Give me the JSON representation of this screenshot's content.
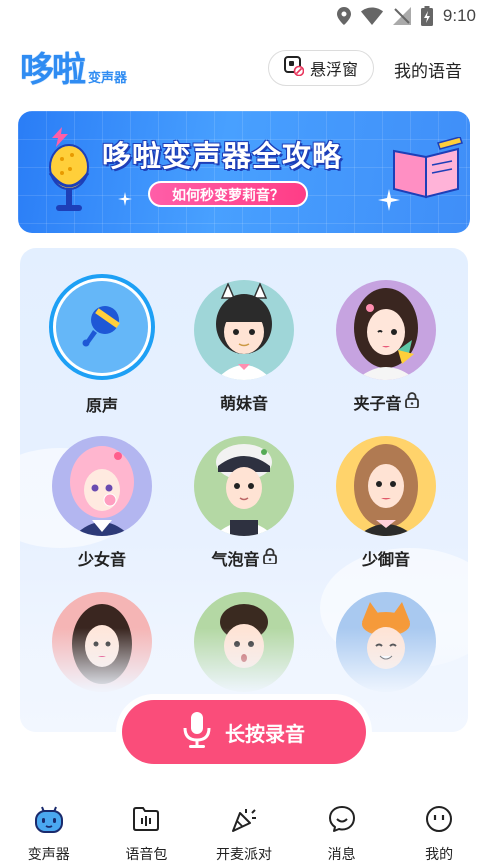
{
  "status_bar": {
    "time": "9:10"
  },
  "header": {
    "logo_text": "哆啦",
    "logo_sub": "变声器",
    "float_window_label": "悬浮窗",
    "my_voice_label": "我的语音"
  },
  "banner": {
    "title": "哆啦变声器全攻略",
    "subtitle": "如何秒变萝莉音？"
  },
  "voices": [
    {
      "label": "原声",
      "locked": false,
      "selected": true
    },
    {
      "label": "萌妹音",
      "locked": false,
      "selected": false
    },
    {
      "label": "夹子音",
      "locked": true,
      "selected": false
    },
    {
      "label": "少女音",
      "locked": false,
      "selected": false
    },
    {
      "label": "气泡音",
      "locked": true,
      "selected": false
    },
    {
      "label": "少御音",
      "locked": false,
      "selected": false
    }
  ],
  "record_button": {
    "label": "长按录音"
  },
  "bottom_nav": [
    {
      "label": "变声器",
      "icon": "robot-icon",
      "active": true
    },
    {
      "label": "语音包",
      "icon": "folder-voice-icon",
      "active": false
    },
    {
      "label": "开麦派对",
      "icon": "party-icon",
      "active": false
    },
    {
      "label": "消息",
      "icon": "chat-icon",
      "active": false
    },
    {
      "label": "我的",
      "icon": "face-icon",
      "active": false
    }
  ],
  "colors": {
    "brand_blue": "#2f8cf2",
    "record_pink": "#fa4d7a",
    "selected_ring": "#1ea0f5",
    "panel_bg": "#e6f0ff"
  }
}
